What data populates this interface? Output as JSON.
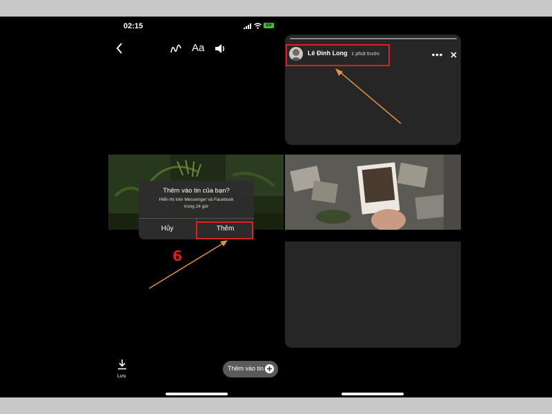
{
  "status_bar": {
    "time": "02:15",
    "battery": "EXI"
  },
  "editor_toolbar": {
    "back_icon": "chevron-left-icon",
    "draw_icon": "squiggle-draw-icon",
    "text_tool_label": "Aa",
    "sound_icon": "speaker-icon"
  },
  "dialog": {
    "title": "Thêm vào tin của bạn?",
    "message_line1": "Hiển thị trên Messenger và Facebook",
    "message_line2": "trong 24 giờ",
    "cancel_label": "Hủy",
    "confirm_label": "Thêm"
  },
  "annotation": {
    "step_number": "6",
    "highlight_color": "#e02020",
    "arrow_color": "#e8923a"
  },
  "bottom_bar": {
    "save_label": "Lưu",
    "add_to_story_label": "Thêm vào tin"
  },
  "story_viewer": {
    "user_name": "Lê Đình Long",
    "time_ago": "1 phút trước",
    "more_icon": "more-dots-icon",
    "close_icon": "close-icon"
  }
}
